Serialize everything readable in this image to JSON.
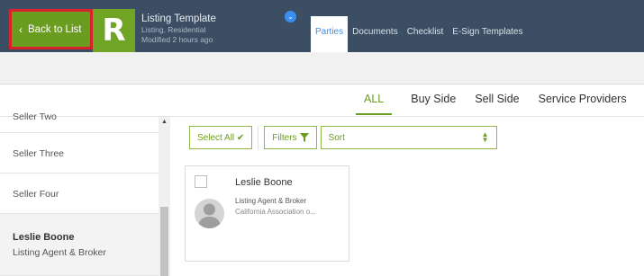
{
  "header": {
    "back_label": "Back to List",
    "logo_letter": "R",
    "template_title": "Listing Template",
    "template_type": "Listing, Residential",
    "modified": "Modified 2 hours ago",
    "tabs": [
      {
        "label": "Parties",
        "active": true
      },
      {
        "label": "Documents",
        "active": false
      },
      {
        "label": "Checklist",
        "active": false
      },
      {
        "label": "E-Sign Templates",
        "active": false
      }
    ]
  },
  "filter_tabs": [
    {
      "label": "ALL",
      "active": true
    },
    {
      "label": "Buy Side",
      "active": false
    },
    {
      "label": "Sell Side",
      "active": false
    },
    {
      "label": "Service Providers",
      "active": false
    }
  ],
  "sidebar": {
    "items": [
      {
        "name": "Seller Two"
      },
      {
        "name": "Seller Three"
      },
      {
        "name": "Seller Four"
      },
      {
        "name": "Leslie Boone",
        "role": "Listing Agent & Broker",
        "selected": true
      }
    ]
  },
  "toolbar": {
    "select_all": "Select All ✔",
    "filters": "Filters",
    "sort": "Sort"
  },
  "card": {
    "name": "Leslie Boone",
    "role": "Listing Agent & Broker",
    "org": "California Association o..."
  },
  "colors": {
    "header_bg": "#3c4e63",
    "accent_green": "#6a9c1f",
    "highlight_red": "#d8222a",
    "active_tab_blue": "#3a8ef2"
  }
}
